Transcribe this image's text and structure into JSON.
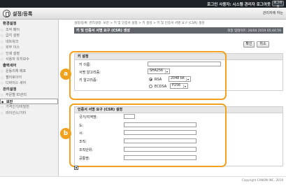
{
  "topbar": {
    "user_text": "로그인 사용자: 시스템 관리자 로그아웃",
    "logout_label": "로그아웃"
  },
  "header": {
    "title": "설정/등록",
    "portal_link": "관리자에 하는"
  },
  "sidebar": {
    "groups": [
      {
        "label": "환경설정",
        "items": [
          "조작 패어",
          "급지 설정",
          "네트워크",
          "외부 이스",
          "인쇄 설정",
          "사용자 유지보수"
        ]
      },
      {
        "label": "출력세어",
        "items": [
          "운동리체 메포",
          "첼러로이어",
          "디바이스 세어"
        ]
      },
      {
        "label": "관리설정",
        "items": [
          "부문별 ID관리",
          "보안",
          "가격인가/비밀번",
          "라이선스/기타"
        ]
      }
    ],
    "selected": "보안"
  },
  "breadcrumb": "설정/등록: 관리설정: 보안 > 키 및 인증서 설정 > 키 생성 > 키 및 인증서 서명 요구 (CSR) 생성",
  "panel": {
    "title": "키 및 인증서 서명 요구 (CSR) 생성",
    "timestamp": "최종 업데이트: 26/04 2019 05:44:59",
    "ok_label": "확인",
    "cancel_label": "취소"
  },
  "key_settings": {
    "section_title": "키 설정",
    "key_name_label": "키 이름:",
    "key_name_value": "",
    "sig_algo_label": "서명 알고리즘:",
    "sig_algo_value": "SHA256",
    "key_algo_label": "키 알고리즘:",
    "rsa_label": "RSA",
    "rsa_bits_value": "2048 bit",
    "ecdsa_label": "ECDSA",
    "ecdsa_curve_value": "P256"
  },
  "csr": {
    "section_title": "인증서 서명 요구 (CSR) 설정",
    "country_label": "국가/지역명:",
    "state_label": "도:",
    "city_label": "시:",
    "org_label": "조직:",
    "org_unit_label": "조직단위:",
    "common_label": "공통명:"
  },
  "callouts": {
    "a": "a",
    "b": "b"
  },
  "footer": {
    "copyright": "Copyright CANON INC. 2019"
  },
  "colors": {
    "accent": "#f0a21e",
    "titlebar": "#5f656a",
    "topbar": "#1c2228"
  }
}
